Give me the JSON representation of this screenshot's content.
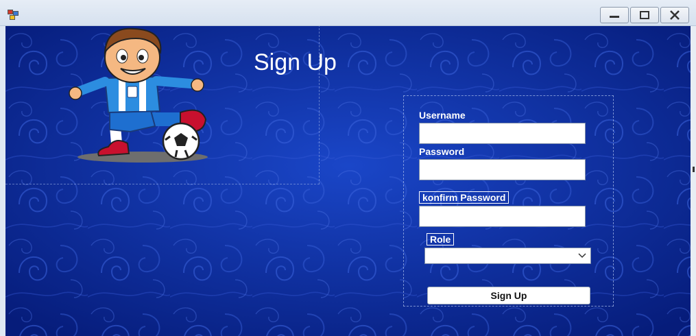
{
  "window": {
    "icon": "app-icon",
    "controls": {
      "minimize": "minimize-icon",
      "maximize": "maximize-icon",
      "close": "close-icon"
    }
  },
  "colors": {
    "background": "#0a2a9a",
    "swirl": "#2a55d0",
    "label": "#ffffff"
  },
  "heading": "Sign Up",
  "form": {
    "username_label": "Username",
    "username_value": "",
    "password_label": "Password",
    "password_value": "",
    "confirm_label": "konfirm Password",
    "confirm_value": "",
    "role_label": "Role",
    "role_value": "",
    "submit_label": "Sign Up"
  }
}
